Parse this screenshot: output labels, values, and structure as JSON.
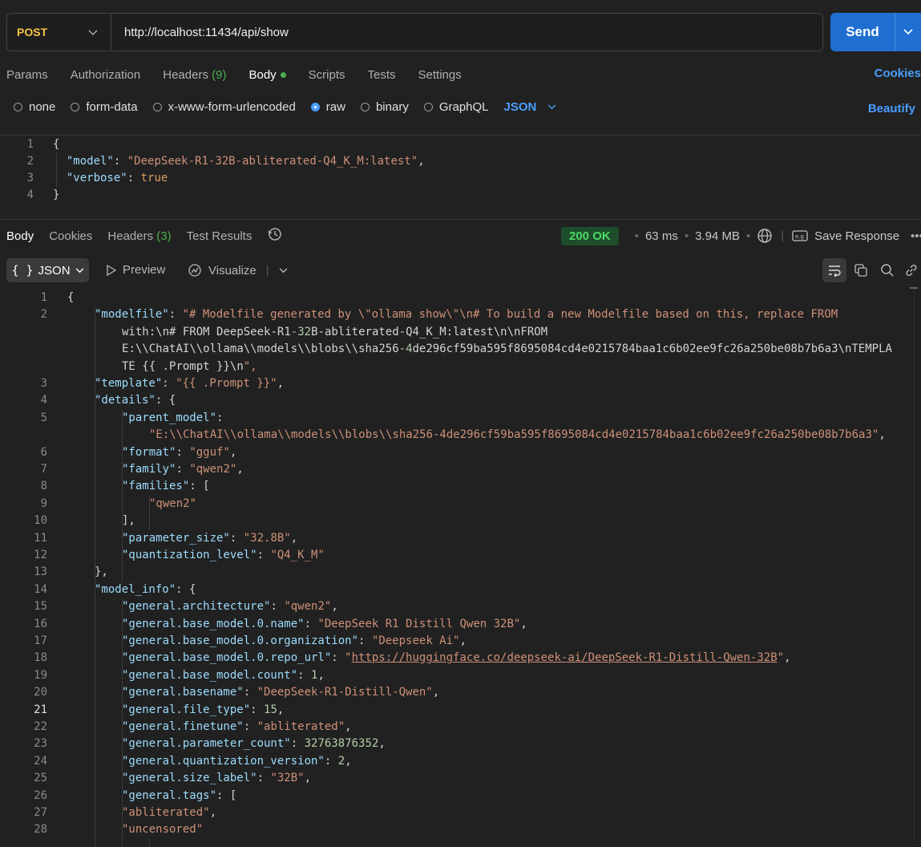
{
  "request": {
    "method": "POST",
    "url": "http://localhost:11434/api/show",
    "send_label": "Send"
  },
  "request_tabs": {
    "params": "Params",
    "authorization": "Authorization",
    "headers": "Headers",
    "headers_count": "(9)",
    "body": "Body",
    "scripts": "Scripts",
    "tests": "Tests",
    "settings": "Settings",
    "cookies": "Cookies"
  },
  "body_types": {
    "none": "none",
    "form_data": "form-data",
    "urlencoded": "x-www-form-urlencoded",
    "raw": "raw",
    "binary": "binary",
    "graphql": "GraphQL",
    "selected": "raw",
    "language": "JSON",
    "beautify": "Beautify"
  },
  "request_body_lines": [
    "{",
    "  \"model\": \"DeepSeek-R1-32B-abliterated-Q4_K_M:latest\",",
    "  \"verbose\": true",
    "}"
  ],
  "response_tabs": {
    "body": "Body",
    "cookies": "Cookies",
    "headers": "Headers",
    "headers_count": "(3)",
    "test_results": "Test Results"
  },
  "response_status": {
    "code": "200 OK",
    "time": "63 ms",
    "size": "3.94 MB",
    "save_response": "Save Response"
  },
  "response_toolbar": {
    "format": "JSON",
    "preview": "Preview",
    "visualize": "Visualize"
  },
  "colors": {
    "send": "#1f6fd1",
    "accent_link": "#4a9eff",
    "method": "#f5c542",
    "status_ok": "#4cd964",
    "json_key": "#9cdcfe",
    "json_string": "#ce9178",
    "json_number": "#b5cea8"
  },
  "response_body": [
    {
      "n": "1",
      "text": "{"
    },
    {
      "n": "2",
      "text": "\"modelfile\": \"# Modelfile generated by \\\"ollama show\\\"\\n# To build a new Modelfile based on this, replace FROM"
    },
    {
      "n": "",
      "text": "with:\\n# FROM DeepSeek-R1-32B-abliterated-Q4_K_M:latest\\n\\nFROM"
    },
    {
      "n": "",
      "text": "E:\\\\ChatAI\\\\ollama\\\\models\\\\blobs\\\\sha256-4de296cf59ba595f8695084cd4e0215784baa1c6b02ee9fc26a250be08b7b6a3\\nTEMPLA"
    },
    {
      "n": "",
      "text": "TE {{ .Prompt }}\\n\","
    },
    {
      "n": "3",
      "text": "\"template\": \"{{ .Prompt }}\","
    },
    {
      "n": "4",
      "text": "\"details\": {"
    },
    {
      "n": "5",
      "text": "\"parent_model\":"
    },
    {
      "n": "",
      "text": "\"E:\\\\ChatAI\\\\ollama\\\\models\\\\blobs\\\\sha256-4de296cf59ba595f8695084cd4e0215784baa1c6b02ee9fc26a250be08b7b6a3\","
    },
    {
      "n": "6",
      "text": "\"format\": \"gguf\","
    },
    {
      "n": "7",
      "text": "\"family\": \"qwen2\","
    },
    {
      "n": "8",
      "text": "\"families\": ["
    },
    {
      "n": "9",
      "text": "\"qwen2\""
    },
    {
      "n": "10",
      "text": "],"
    },
    {
      "n": "11",
      "text": "\"parameter_size\": \"32.8B\","
    },
    {
      "n": "12",
      "text": "\"quantization_level\": \"Q4_K_M\""
    },
    {
      "n": "13",
      "text": "},"
    },
    {
      "n": "14",
      "text": "\"model_info\": {"
    },
    {
      "n": "15",
      "text": "\"general.architecture\": \"qwen2\","
    },
    {
      "n": "16",
      "text": "\"general.base_model.0.name\": \"DeepSeek R1 Distill Qwen 32B\","
    },
    {
      "n": "17",
      "text": "\"general.base_model.0.organization\": \"Deepseek Ai\","
    },
    {
      "n": "18",
      "text": "\"general.base_model.0.repo_url\": \"https://huggingface.co/deepseek-ai/DeepSeek-R1-Distill-Qwen-32B\","
    },
    {
      "n": "19",
      "text": "\"general.base_model.count\": 1,"
    },
    {
      "n": "20",
      "text": "\"general.basename\": \"DeepSeek-R1-Distill-Qwen\","
    },
    {
      "n": "21",
      "text": "\"general.file_type\": 15,"
    },
    {
      "n": "22",
      "text": "\"general.finetune\": \"abliterated\","
    },
    {
      "n": "23",
      "text": "\"general.parameter_count\": 32763876352,"
    },
    {
      "n": "24",
      "text": "\"general.quantization_version\": 2,"
    },
    {
      "n": "25",
      "text": "\"general.size_label\": \"32B\","
    },
    {
      "n": "26",
      "text": "\"general.tags\": ["
    },
    {
      "n": "27",
      "text": "\"abliterated\","
    },
    {
      "n": "28",
      "text": "\"uncensored\""
    }
  ]
}
